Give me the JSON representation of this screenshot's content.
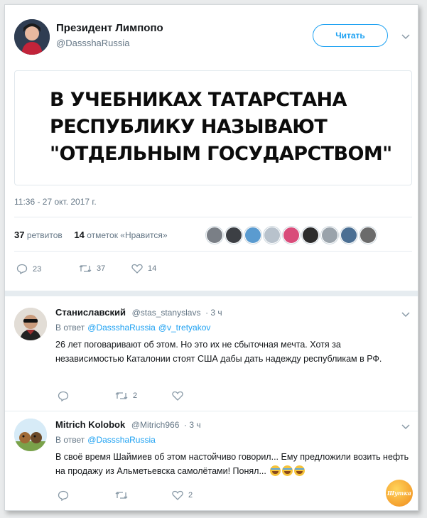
{
  "tweet": {
    "author_name": "Президент Лимпопо",
    "author_handle": "@DassshaRussia",
    "follow_label": "Читать",
    "headline_lines": [
      "В УЧЕБНИКАХ ТАТАРСТАНА",
      "РЕСПУБЛИКУ НАЗЫВАЮТ",
      "\"ОТДЕЛЬНЫМ ГОСУДАРСТВОМ\""
    ],
    "timestamp": "11:36 - 27 окт. 2017 г.",
    "retweets_count": "37",
    "retweets_label": "ретвитов",
    "likes_count": "14",
    "likes_label": "отметок «Нравится»",
    "actions": {
      "replies": "23",
      "retweets": "37",
      "likes": "14"
    }
  },
  "replies": [
    {
      "name": "Станиславский",
      "handle": "@stas_stanyslavs",
      "time": "· 3 ч",
      "in_reply_label": "В ответ",
      "in_reply_to": [
        "@DassshaRussia",
        "@v_tretyakov"
      ],
      "text": "26 лет поговаривают об этом. Но это их не сбыточная мечта. Хотя за независимостью Каталонии стоят США дабы дать надежду республикам в РФ.",
      "actions": {
        "replies": "",
        "retweets": "2",
        "likes": ""
      }
    },
    {
      "name": "Mitrich Kolobok",
      "handle": "@Mitrich966",
      "time": "· 3 ч",
      "in_reply_label": "В ответ",
      "in_reply_to": [
        "@DassshaRussia"
      ],
      "text": "В своё время Шаймиев об этом настойчиво говорил... Ему предложили возить нефть на продажу из Альметьевска самолётами! Понял...",
      "actions": {
        "replies": "",
        "retweets": "",
        "likes": "2"
      }
    }
  ],
  "colors": {
    "accent": "#1da1f2",
    "muted": "#657786",
    "text": "#14171a"
  },
  "icons": [
    "caret-down-icon",
    "reply-icon",
    "retweet-icon",
    "heart-icon",
    "laughing-emoji-icon"
  ],
  "watermark_text": "Шутка"
}
